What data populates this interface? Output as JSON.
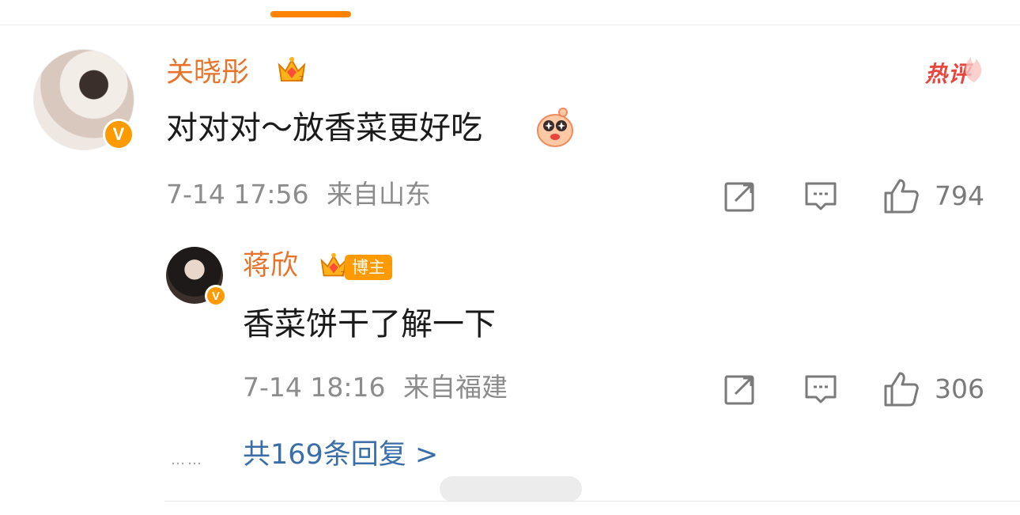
{
  "comment": {
    "author": "关晓彤",
    "hot_label": "热评",
    "text": "对对对～放香菜更好吃",
    "date": "7-14 17:56",
    "location": "来自山东",
    "likes": "794"
  },
  "reply": {
    "author": "蒋欣",
    "badge": "博主",
    "text": "香菜饼干了解一下",
    "date": "7-14 18:16",
    "location": "来自福建",
    "likes": "306"
  },
  "more_replies": {
    "dots": "……",
    "label": "共169条回复 >"
  },
  "colors": {
    "accent": "#ff8200",
    "name": "#e8742c",
    "link": "#3b6ea8",
    "hot": "#e8453c"
  }
}
